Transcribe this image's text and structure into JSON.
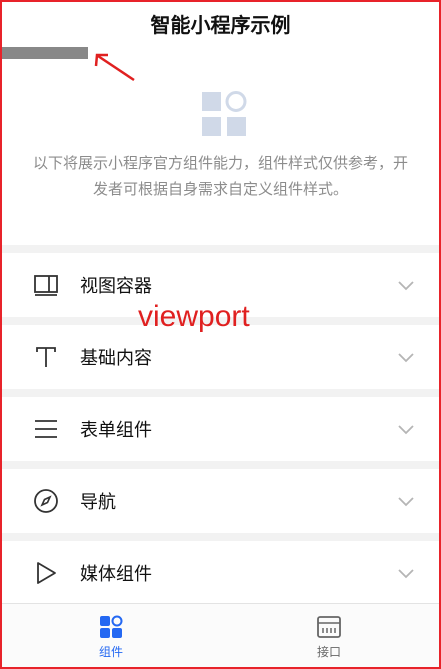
{
  "header": {
    "title": "智能小程序示例"
  },
  "intro": {
    "text": "以下将展示小程序官方组件能力，组件样式仅供参考，开发者可根据自身需求自定义组件样式。"
  },
  "list": {
    "items": [
      {
        "label": "视图容器",
        "icon": "view-container-icon"
      },
      {
        "label": "基础内容",
        "icon": "text-t-icon"
      },
      {
        "label": "表单组件",
        "icon": "form-lines-icon"
      },
      {
        "label": "导航",
        "icon": "compass-icon"
      },
      {
        "label": "媒体组件",
        "icon": "play-icon"
      }
    ]
  },
  "annotation": {
    "viewport_label": "viewport"
  },
  "tabbar": {
    "tabs": [
      {
        "label": "组件",
        "icon": "components-icon",
        "active": true
      },
      {
        "label": "接口",
        "icon": "api-icon",
        "active": false
      }
    ]
  },
  "colors": {
    "accent": "#2468f2",
    "annotation": "#e02020",
    "icon_light": "#d0d9e8"
  }
}
